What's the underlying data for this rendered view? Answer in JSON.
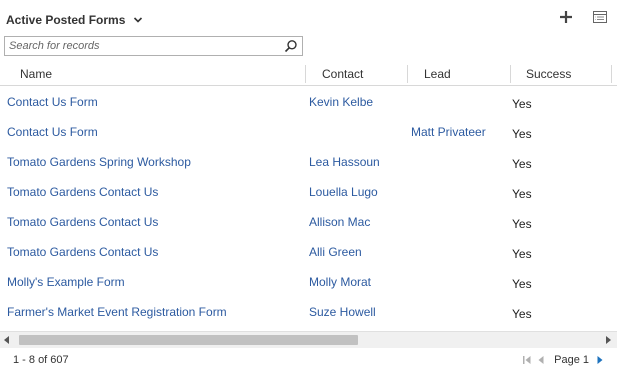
{
  "view": {
    "title": "Active Posted Forms"
  },
  "search": {
    "placeholder": "Search for records",
    "value": ""
  },
  "columns": [
    "Name",
    "Contact",
    "Lead",
    "Success"
  ],
  "rows": [
    {
      "name": "Contact Us Form",
      "contact": "Kevin Kelbe",
      "lead": "",
      "success": "Yes"
    },
    {
      "name": "Contact Us Form",
      "contact": "",
      "lead": "Matt Privateer",
      "success": "Yes"
    },
    {
      "name": "Tomato Gardens Spring Workshop",
      "contact": "Lea Hassoun",
      "lead": "",
      "success": "Yes"
    },
    {
      "name": "Tomato Gardens Contact Us",
      "contact": "Louella Lugo",
      "lead": "",
      "success": "Yes"
    },
    {
      "name": "Tomato Gardens Contact Us",
      "contact": "Allison Mac",
      "lead": "",
      "success": "Yes"
    },
    {
      "name": "Tomato Gardens Contact Us",
      "contact": "Alli Green",
      "lead": "",
      "success": "Yes"
    },
    {
      "name": "Molly's Example Form",
      "contact": "Molly Morat",
      "lead": "",
      "success": "Yes"
    },
    {
      "name": "Farmer's Market Event Registration Form",
      "contact": "Suze Howell",
      "lead": "",
      "success": "Yes"
    }
  ],
  "footer": {
    "record_count": "1 - 8 of 607",
    "page_label": "Page 1"
  },
  "colors": {
    "link": "#2c5aa0",
    "divider": "#d8d8d8",
    "scroll_thumb": "#c1c1c1"
  },
  "icons": {
    "chevron": "chevron-down-icon",
    "add": "plus-icon",
    "grid": "grid-view-icon",
    "search": "search-icon",
    "first_page": "first-page-icon",
    "prev_page": "previous-page-icon",
    "next_page": "next-page-icon"
  }
}
